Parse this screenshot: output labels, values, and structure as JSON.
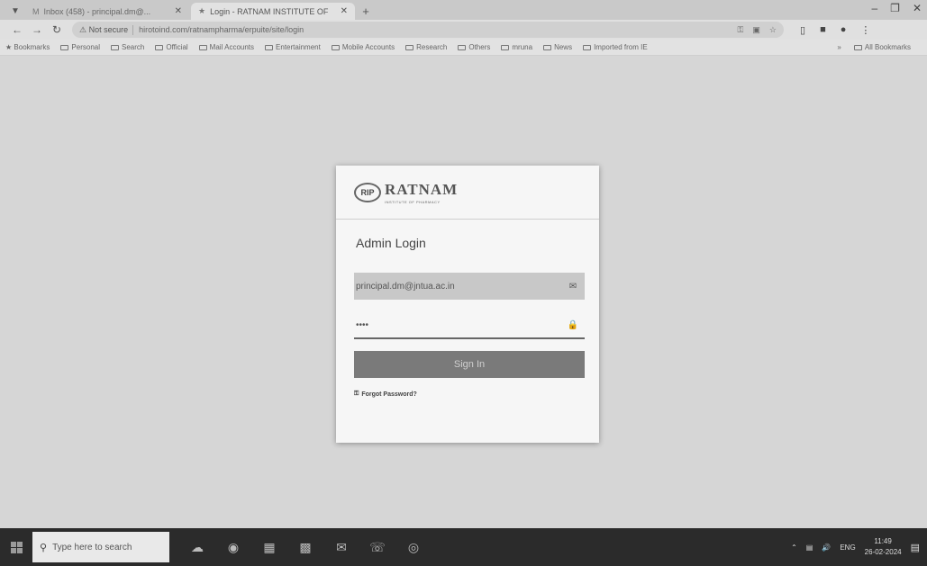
{
  "browser": {
    "tabs": [
      {
        "favicon": "M",
        "label": "Inbox (458) - principal.dm@...",
        "active": false
      },
      {
        "favicon": "★",
        "label": "Login - RATNAM INSTITUTE OF",
        "active": true
      }
    ],
    "new_tab": "+",
    "window_controls": {
      "minimize": "–",
      "restore": "❐",
      "close": "✕"
    },
    "secure_label": "⚠ Not secure",
    "url": "hirotoind.com/ratnampharma/erpuite/site/login",
    "bookmarks": [
      "Bookmarks",
      "Personal",
      "Search",
      "Official",
      "Mail Accounts",
      "Entertainment",
      "Mobile Accounts",
      "Research",
      "Others",
      "mruna",
      "News",
      "Imported from IE"
    ],
    "bookmarks_more": "»",
    "all_bookmarks": "All Bookmarks"
  },
  "login": {
    "logo_mark": "RIP",
    "logo_name": "RATNAM",
    "logo_sub": "INSTITUTE OF PHARMACY",
    "title": "Admin Login",
    "email_value": "principal.dm@jntua.ac.in",
    "password_value": "••••",
    "signin_label": "Sign In",
    "forgot_label": "Forgot Password?"
  },
  "taskbar": {
    "search_placeholder": "Type here to search",
    "tray_lang": "ENG",
    "time": "11:49",
    "date": "26-02-2024"
  }
}
